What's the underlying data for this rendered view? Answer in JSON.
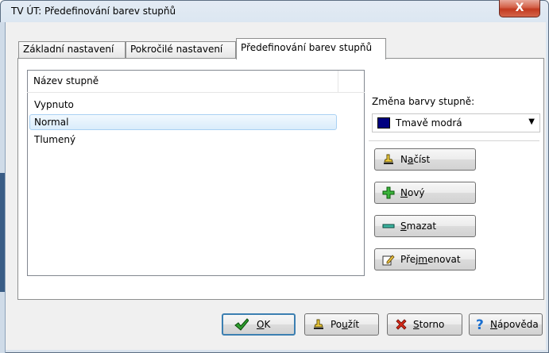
{
  "window": {
    "title": "TV ÚT: Předefinování barev stupňů",
    "close_label": "X"
  },
  "tabs": [
    {
      "label": "Základní nastavení"
    },
    {
      "label": "Pokročilé nastavení"
    },
    {
      "label": "Předefinování barev stupňů"
    }
  ],
  "list": {
    "column_header": "Název stupně",
    "items": [
      {
        "label": "Vypnuto"
      },
      {
        "label": "Normal"
      },
      {
        "label": "Tlumený"
      }
    ]
  },
  "color": {
    "label": "Změna barvy stupně:",
    "selected": "Tmavě modrá",
    "swatch": "#000080"
  },
  "side_buttons": {
    "load": {
      "prefix": "N",
      "underline": "a",
      "suffix": "číst"
    },
    "new": {
      "prefix": "",
      "underline": "N",
      "suffix": "ový"
    },
    "delete": {
      "prefix": "",
      "underline": "S",
      "suffix": "mazat"
    },
    "rename": {
      "prefix": "Přej",
      "underline": "m",
      "suffix": "enovat"
    }
  },
  "bottom_buttons": {
    "ok": {
      "prefix": "",
      "underline": "O",
      "suffix": "K"
    },
    "apply": {
      "prefix": "Po",
      "underline": "u",
      "suffix": "žít"
    },
    "cancel": {
      "prefix": "",
      "underline": "S",
      "suffix": "torno"
    },
    "help": {
      "prefix": "",
      "underline": "N",
      "suffix": "ápověda"
    }
  }
}
